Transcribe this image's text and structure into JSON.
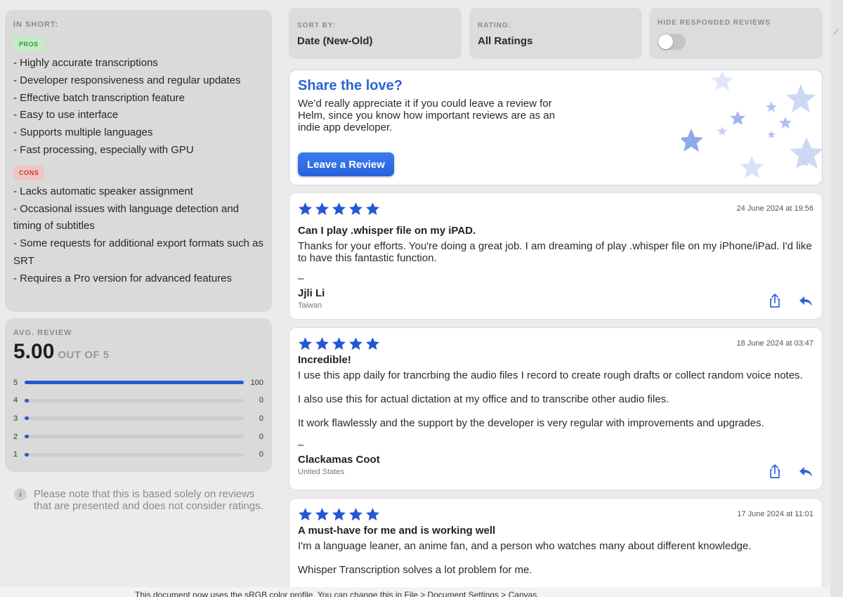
{
  "summary": {
    "heading": "IN SHORT:",
    "pros_label": "PROS",
    "pros": [
      "- Highly accurate transcriptions",
      "- Developer responsiveness and regular updates",
      "- Effective batch transcription feature",
      "- Easy to use interface",
      "- Supports multiple languages",
      "- Fast processing, especially with GPU"
    ],
    "cons_label": "CONS",
    "cons": [
      "- Lacks automatic speaker assignment",
      "- Occasional issues with language detection and timing of subtitles",
      "- Some requests for additional export formats such as SRT",
      "- Requires a Pro version for advanced features"
    ]
  },
  "avg_review": {
    "heading": "AVG. REVIEW",
    "score": "5.00",
    "out_of": "OUT OF 5",
    "distribution": [
      {
        "stars": "5",
        "count": "100",
        "fraction": 1.0
      },
      {
        "stars": "4",
        "count": "0",
        "fraction": 0
      },
      {
        "stars": "3",
        "count": "0",
        "fraction": 0
      },
      {
        "stars": "2",
        "count": "0",
        "fraction": 0
      },
      {
        "stars": "1",
        "count": "0",
        "fraction": 0
      }
    ]
  },
  "note": "Please note that this is based solely on reviews that are presented and does not consider ratings.",
  "filters": {
    "sort_label": "SORT BY:",
    "sort_value": "Date (New-Old)",
    "rating_label": "RATING:",
    "rating_value": "All Ratings",
    "hide_label": "HIDE RESPONDED REVIEWS",
    "hide_on": false
  },
  "promo": {
    "title": "Share the love?",
    "body": "We’d really appreciate it if you could leave a review for Helm, since you know how important reviews are as an indie app developer.",
    "button": "Leave a Review"
  },
  "reviews": [
    {
      "rating": 5,
      "date": "24 June 2024 at 19:56",
      "title": "Can I play .whisper file on my iPAD.",
      "body": [
        "Thanks for your efforts. You're doing a great job. I am dreaming of play .whisper file on my iPhone/iPad. I'd like to have this fantastic function."
      ],
      "dash": "–",
      "author": "Jjli Li",
      "country": "Taiwan"
    },
    {
      "rating": 5,
      "date": "18 June 2024 at 03:47",
      "title": "Incredible!",
      "body": [
        "I use this app daily for trancrbing the audio files I record to create rough drafts or collect random voice notes.",
        "I also use this for actual dictation at my office and to transcribe other audio files.",
        "It work flawlessly and the support by the developer is very regular with improvements and upgrades."
      ],
      "dash": "–",
      "author": "Clackamas Coot",
      "country": "United States"
    },
    {
      "rating": 5,
      "date": "17 June 2024 at 11:01",
      "title": "A must-have for me and is working well",
      "body": [
        "I'm a language leaner, an anime fan, and a person who watches many about different knowledge.",
        "Whisper Transcription solves a lot problem for me."
      ]
    }
  ],
  "background_text": "This document now uses the sRGB color profile. You can change this in File > Document Settings > Canvas.",
  "colors": {
    "accent": "#2657cf",
    "star": "#2358d3",
    "pros_bg": "#c6ecc6",
    "cons_bg": "#f1c4c4"
  }
}
